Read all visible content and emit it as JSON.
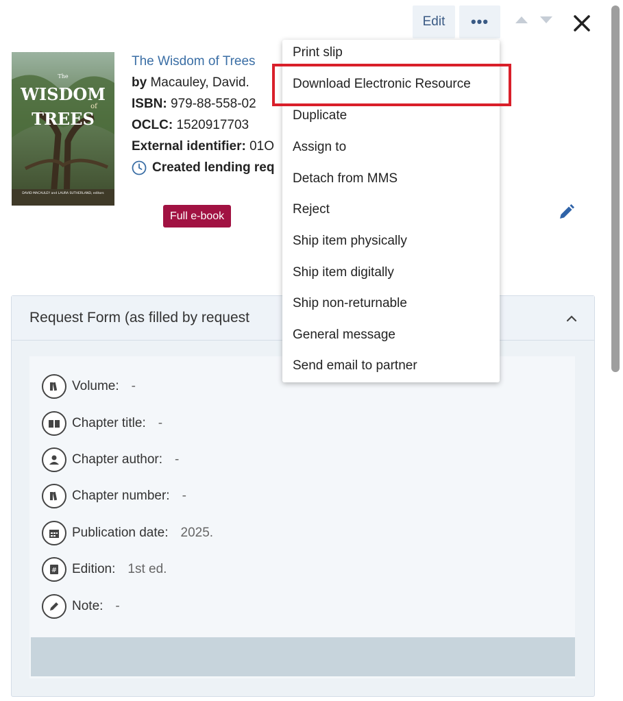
{
  "toolbar": {
    "edit_label": "Edit",
    "more_label": "•••"
  },
  "cover": {
    "title_line1": "WISDOM",
    "title_small": "of",
    "title_line2": "TREES",
    "editors": "DAVID MACAULEY and LAURA SUTHERLAND, editors"
  },
  "record": {
    "title": "The Wisdom of Trees",
    "by_label": "by",
    "author": "Macauley, David.",
    "isbn_label": "ISBN:",
    "isbn": "979-88-558-02",
    "oclc_label": "OCLC:",
    "oclc": "1520917703",
    "extid_label": "External identifier:",
    "extid": "01O",
    "created_text": "Created lending req"
  },
  "badge": {
    "label": "Full e-book",
    "color": "#a11242"
  },
  "panel": {
    "title": "Request Form (as filled by request",
    "fields": [
      {
        "label": "Volume:",
        "value": "-",
        "icon": "books-icon"
      },
      {
        "label": "Chapter title:",
        "value": "-",
        "icon": "open-book-icon"
      },
      {
        "label": "Chapter author:",
        "value": "-",
        "icon": "person-icon"
      },
      {
        "label": "Chapter number:",
        "value": "-",
        "icon": "books-icon"
      },
      {
        "label": "Publication date:",
        "value": "2025.",
        "icon": "calendar-icon"
      },
      {
        "label": "Edition:",
        "value": "1st ed.",
        "icon": "hash-book-icon"
      },
      {
        "label": "Note:",
        "value": "-",
        "icon": "pencil-icon"
      }
    ]
  },
  "menu": {
    "items": [
      "Print slip",
      "Download Electronic Resource",
      "Duplicate",
      "Assign to",
      "Detach from MMS",
      "Reject",
      "Ship item physically",
      "Ship item digitally",
      "Ship non-returnable",
      "General message",
      "Send email to partner"
    ]
  },
  "colors": {
    "accent": "#3a6ea5",
    "highlight": "#d91f2a"
  }
}
